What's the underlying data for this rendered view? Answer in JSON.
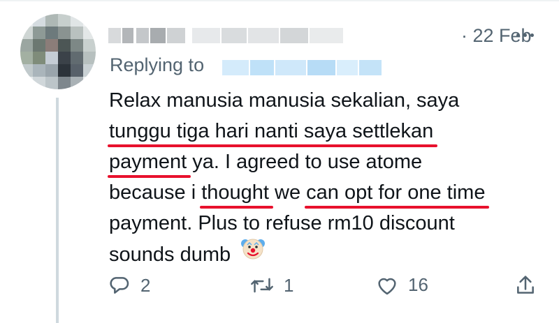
{
  "tweet": {
    "timestamp": "· 22 Feb",
    "replying_to_label": "Replying to",
    "text_lines": [
      {
        "parts": [
          {
            "t": "Relax manusia manusia sekalian, saya",
            "u": false
          }
        ]
      },
      {
        "parts": [
          {
            "t": "tunggu tiga hari nanti saya settlekan",
            "u": true
          }
        ]
      },
      {
        "parts": [
          {
            "t": "payment",
            "u": true
          },
          {
            "t": " ya. I agreed to use atome",
            "u": false
          }
        ]
      },
      {
        "parts": [
          {
            "t": "because i ",
            "u": false
          },
          {
            "t": "thought",
            "u": true
          },
          {
            "t": " we ",
            "u": false
          },
          {
            "t": "can opt for one time",
            "u": true
          }
        ]
      },
      {
        "parts": [
          {
            "t": "payment. Plus to refuse rm10 discount",
            "u": false
          }
        ]
      },
      {
        "parts": [
          {
            "t": "sounds dumb",
            "u": false
          }
        ]
      }
    ],
    "emoji_icon": "clown-face-icon"
  },
  "actions": {
    "reply_count": "2",
    "retweet_count": "1",
    "like_count": "16"
  },
  "colors": {
    "secondary_text": "#536471",
    "underline_annotation": "#e8112d",
    "thread_line": "#cfd9de"
  }
}
